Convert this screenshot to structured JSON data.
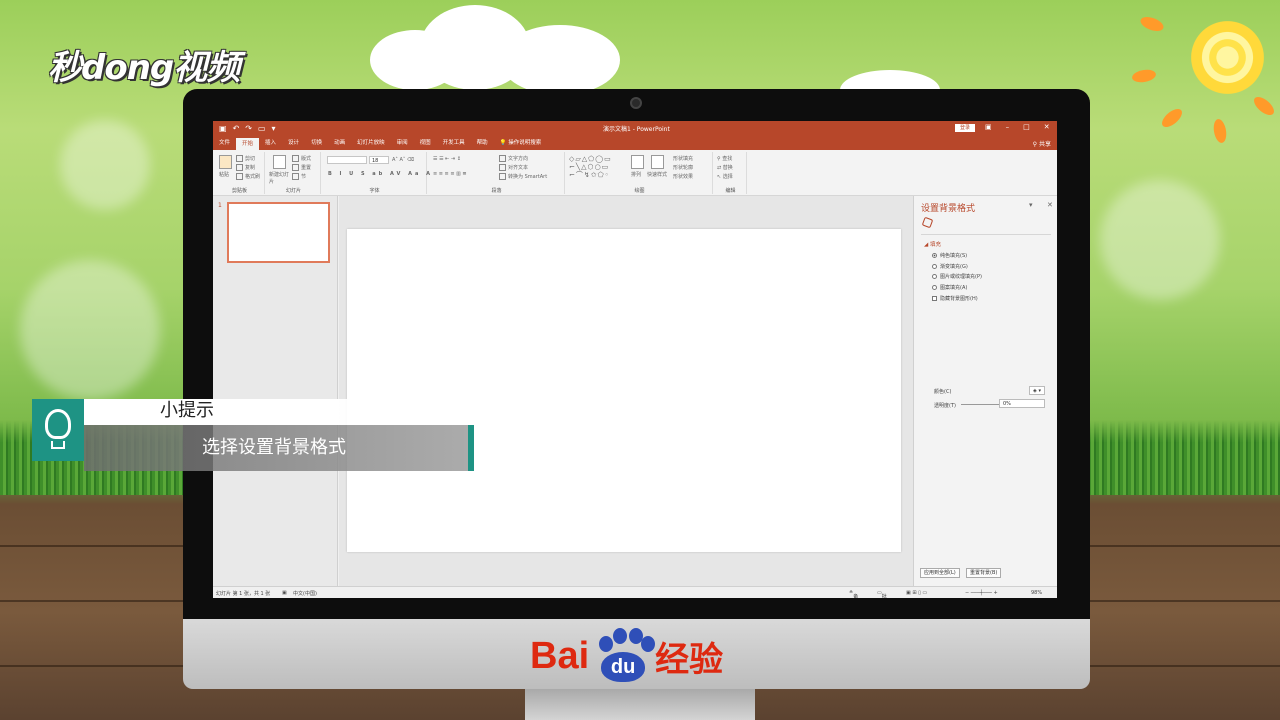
{
  "background": {
    "site_logo": "秒dong视频"
  },
  "tip": {
    "heading": "小提示",
    "text": "选择设置背景格式"
  },
  "brand": {
    "baidu_text": "Bai",
    "baidu_du": "du",
    "baidu_cn": "经验"
  },
  "ppt": {
    "title": "演示文稿1  -  PowerPoint",
    "login": "登录",
    "share": "共享",
    "tabs": [
      "文件",
      "开始",
      "插入",
      "设计",
      "切换",
      "动画",
      "幻灯片放映",
      "审阅",
      "视图",
      "开发工具",
      "帮助",
      "操作说明搜索"
    ],
    "ribbon": {
      "clipboard": {
        "paste": "粘贴",
        "cut": "剪切",
        "copy": "复制",
        "format_painter": "格式刷",
        "name": "剪贴板"
      },
      "slides": {
        "new_slide": "新建幻灯片",
        "layout": "版式",
        "reset": "重置",
        "section": "节",
        "name": "幻灯片"
      },
      "font": {
        "name": "字体",
        "size": "18"
      },
      "paragraph": {
        "text_direction": "文字方向",
        "align_text": "对齐文本",
        "smartart": "转换为 SmartArt",
        "name": "段落"
      },
      "drawing": {
        "arrange": "排列",
        "quick_styles": "快速样式",
        "shape_fill": "形状填充",
        "shape_outline": "形状轮廓",
        "shape_effects": "形状效果",
        "name": "绘图"
      },
      "editing": {
        "find": "查找",
        "replace": "替换",
        "select": "选择",
        "name": "编辑"
      }
    },
    "thumbnail_number": "1",
    "format_pane": {
      "title": "设置背景格式",
      "section": "填充",
      "options": [
        {
          "label": "纯色填充(S)",
          "type": "radio",
          "checked": true
        },
        {
          "label": "渐变填充(G)",
          "type": "radio",
          "checked": false
        },
        {
          "label": "图片或纹理填充(P)",
          "type": "radio",
          "checked": false
        },
        {
          "label": "图案填充(A)",
          "type": "radio",
          "checked": false
        },
        {
          "label": "隐藏背景图形(H)",
          "type": "checkbox",
          "checked": false
        }
      ],
      "color_label": "颜色(C)",
      "transparency_label": "透明度(T)",
      "transparency_value": "0%",
      "apply_all": "应用到全部(L)",
      "reset_bg": "重置背景(B)"
    },
    "status": {
      "slide_info": "幻灯片 第 1 张，共 1 张",
      "language": "中文(中国)",
      "notes": "备注",
      "comments": "批注",
      "zoom": "98%"
    }
  }
}
